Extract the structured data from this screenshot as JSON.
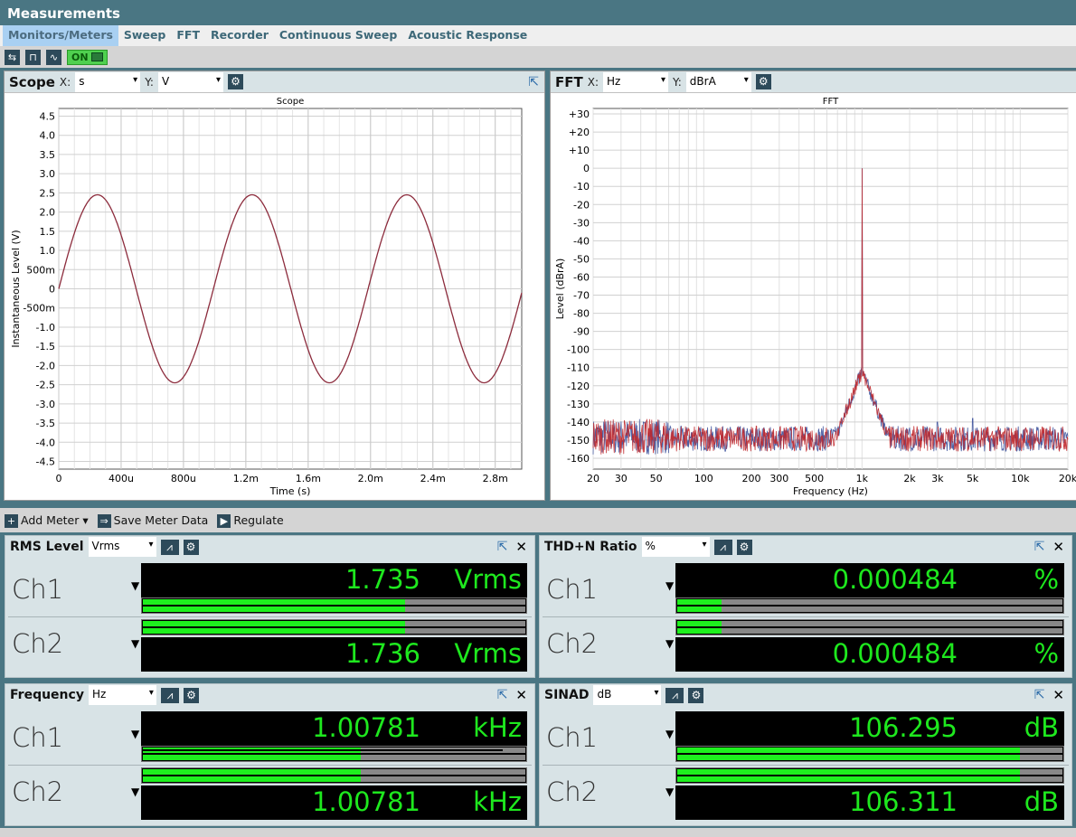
{
  "window": {
    "title": "Measurements"
  },
  "tabs": [
    {
      "label": "Monitors/Meters",
      "active": true
    },
    {
      "label": "Sweep"
    },
    {
      "label": "FFT"
    },
    {
      "label": "Recorder"
    },
    {
      "label": "Continuous Sweep"
    },
    {
      "label": "Acoustic Response"
    }
  ],
  "toolbar": {
    "on_label": "ON",
    "icons": [
      "swap-channels-icon",
      "square-wave-icon",
      "add-waveform-icon"
    ]
  },
  "scope": {
    "title": "Scope",
    "x_label": "X:",
    "x_unit": "s",
    "y_label": "Y:",
    "y_unit": "V"
  },
  "fft": {
    "title": "FFT",
    "x_label": "X:",
    "x_unit": "Hz",
    "y_label": "Y:",
    "y_unit": "dBrA"
  },
  "chart_data": [
    {
      "type": "line",
      "title": "Scope",
      "xlabel": "Time (s)",
      "ylabel": "Instantaneous Level (V)",
      "xlim": [
        0,
        0.00297
      ],
      "ylim": [
        -4.7,
        4.7
      ],
      "grid": true,
      "xticks": [
        {
          "v": 0,
          "l": "0"
        },
        {
          "v": 0.0004,
          "l": "400u"
        },
        {
          "v": 0.0008,
          "l": "800u"
        },
        {
          "v": 0.0012,
          "l": "1.2m"
        },
        {
          "v": 0.0016,
          "l": "1.6m"
        },
        {
          "v": 0.002,
          "l": "2.0m"
        },
        {
          "v": 0.0024,
          "l": "2.4m"
        },
        {
          "v": 0.0028,
          "l": "2.8m"
        }
      ],
      "yticks": [
        {
          "v": 4.5,
          "l": "4.5"
        },
        {
          "v": 4,
          "l": "4.0"
        },
        {
          "v": 3.5,
          "l": "3.5"
        },
        {
          "v": 3,
          "l": "3.0"
        },
        {
          "v": 2.5,
          "l": "2.5"
        },
        {
          "v": 2,
          "l": "2.0"
        },
        {
          "v": 1.5,
          "l": "1.5"
        },
        {
          "v": 1,
          "l": "1.0"
        },
        {
          "v": 0.5,
          "l": "500m"
        },
        {
          "v": 0,
          "l": "0"
        },
        {
          "v": -0.5,
          "l": "-500m"
        },
        {
          "v": -1,
          "l": "-1.0"
        },
        {
          "v": -1.5,
          "l": "-1.5"
        },
        {
          "v": -2,
          "l": "-2.0"
        },
        {
          "v": -2.5,
          "l": "-2.5"
        },
        {
          "v": -3,
          "l": "-3.0"
        },
        {
          "v": -3.5,
          "l": "-3.5"
        },
        {
          "v": -4,
          "l": "-4.0"
        },
        {
          "v": -4.5,
          "l": "-4.5"
        }
      ],
      "series": [
        {
          "waveform": "sine",
          "amplitude": 2.45,
          "frequency_hz": 1007.81,
          "color": "#8c2b3c"
        }
      ]
    },
    {
      "type": "line",
      "title": "FFT",
      "xlabel": "Frequency (Hz)",
      "ylabel": "Level (dBrA)",
      "xscale": "log",
      "xlim": [
        20,
        20000
      ],
      "ylim": [
        -166,
        33
      ],
      "grid": true,
      "xticks": [
        {
          "v": 20,
          "l": "20"
        },
        {
          "v": 30,
          "l": "30"
        },
        {
          "v": 50,
          "l": "50"
        },
        {
          "v": 100,
          "l": "100"
        },
        {
          "v": 200,
          "l": "200"
        },
        {
          "v": 300,
          "l": "300"
        },
        {
          "v": 500,
          "l": "500"
        },
        {
          "v": 1000,
          "l": "1k"
        },
        {
          "v": 2000,
          "l": "2k"
        },
        {
          "v": 3000,
          "l": "3k"
        },
        {
          "v": 5000,
          "l": "5k"
        },
        {
          "v": 10000,
          "l": "10k"
        },
        {
          "v": 20000,
          "l": "20k"
        }
      ],
      "yticks": [
        {
          "v": 30,
          "l": "+30"
        },
        {
          "v": 20,
          "l": "+20"
        },
        {
          "v": 10,
          "l": "+10"
        },
        {
          "v": 0,
          "l": "0"
        },
        {
          "v": -10,
          "l": "-10"
        },
        {
          "v": -20,
          "l": "-20"
        },
        {
          "v": -30,
          "l": "-30"
        },
        {
          "v": -40,
          "l": "-40"
        },
        {
          "v": -50,
          "l": "-50"
        },
        {
          "v": -60,
          "l": "-60"
        },
        {
          "v": -70,
          "l": "-70"
        },
        {
          "v": -80,
          "l": "-80"
        },
        {
          "v": -90,
          "l": "-90"
        },
        {
          "v": -100,
          "l": "-100"
        },
        {
          "v": -110,
          "l": "-110"
        },
        {
          "v": -120,
          "l": "-120"
        },
        {
          "v": -130,
          "l": "-130"
        },
        {
          "v": -140,
          "l": "-140"
        },
        {
          "v": -150,
          "l": "-150"
        },
        {
          "v": -160,
          "l": "-160"
        }
      ],
      "fundamental": {
        "freq": 1000,
        "level": 0
      },
      "noise_floor": -152,
      "spurs": [
        {
          "freq": 2000,
          "level": -143
        },
        {
          "freq": 3000,
          "level": -140
        },
        {
          "freq": 4000,
          "level": -147
        },
        {
          "freq": 5000,
          "level": -138
        },
        {
          "freq": 7000,
          "level": -145
        }
      ],
      "series": [
        {
          "color": "#3a4f9a"
        },
        {
          "color": "#c0282c"
        }
      ]
    }
  ],
  "meter_toolbar": {
    "add_meter": "Add Meter",
    "save": "Save Meter Data",
    "regulate": "Regulate"
  },
  "meters": [
    {
      "title": "RMS Level",
      "unit_select": "Vrms",
      "channels": [
        {
          "label": "Ch1",
          "value": "1.735",
          "unit": "Vrms",
          "bar": 0.686
        },
        {
          "label": "Ch2",
          "value": "1.736",
          "unit": "Vrms",
          "bar": 0.686
        }
      ]
    },
    {
      "title": "THD+N Ratio",
      "unit_select": "%",
      "channels": [
        {
          "label": "Ch1",
          "value": "0.000484",
          "unit": "%",
          "bar": 0.115
        },
        {
          "label": "Ch2",
          "value": "0.000484",
          "unit": "%",
          "bar": 0.115
        }
      ]
    },
    {
      "title": "Frequency",
      "unit_select": "Hz",
      "channels": [
        {
          "label": "Ch1",
          "value": "1.00781",
          "unit": "kHz",
          "bar": 0.57,
          "peak": 0.94
        },
        {
          "label": "Ch2",
          "value": "1.00781",
          "unit": "kHz",
          "bar": 0.57
        }
      ]
    },
    {
      "title": "SINAD",
      "unit_select": "dB",
      "channels": [
        {
          "label": "Ch1",
          "value": "106.295",
          "unit": "dB",
          "bar": 0.89
        },
        {
          "label": "Ch2",
          "value": "106.311",
          "unit": "dB",
          "bar": 0.89
        }
      ]
    }
  ]
}
